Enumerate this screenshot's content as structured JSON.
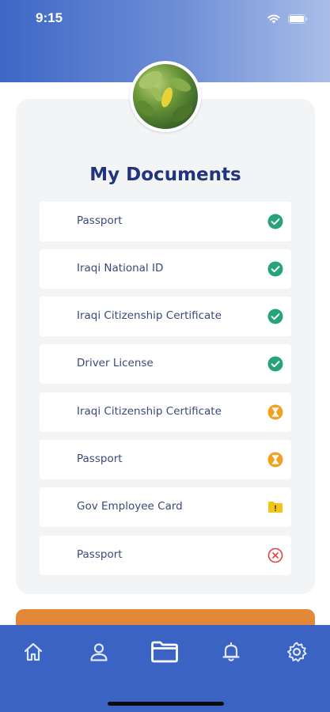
{
  "status_bar": {
    "time": "9:15"
  },
  "main": {
    "title": "My Documents",
    "documents": [
      {
        "label": "Passport",
        "status": "verified"
      },
      {
        "label": "Iraqi National ID",
        "status": "verified"
      },
      {
        "label": "Iraqi Citizenship Certificate",
        "status": "verified"
      },
      {
        "label": "Driver License",
        "status": "verified"
      },
      {
        "label": "Iraqi Citizenship Certificate",
        "status": "pending"
      },
      {
        "label": "Passport",
        "status": "pending"
      },
      {
        "label": "Gov Employee Card",
        "status": "warning"
      },
      {
        "label": "Passport",
        "status": "rejected"
      }
    ]
  },
  "colors": {
    "verified": "#27a37a",
    "pending": "#f0a220",
    "warning": "#f2c516",
    "rejected": "#e04545",
    "accent": "#3b63c4",
    "button": "#e38838"
  },
  "icons": {
    "status_bar": [
      "wifi-icon",
      "battery-icon"
    ],
    "nav": [
      "home-icon",
      "profile-icon",
      "folder-icon",
      "bell-icon",
      "settings-icon"
    ]
  }
}
